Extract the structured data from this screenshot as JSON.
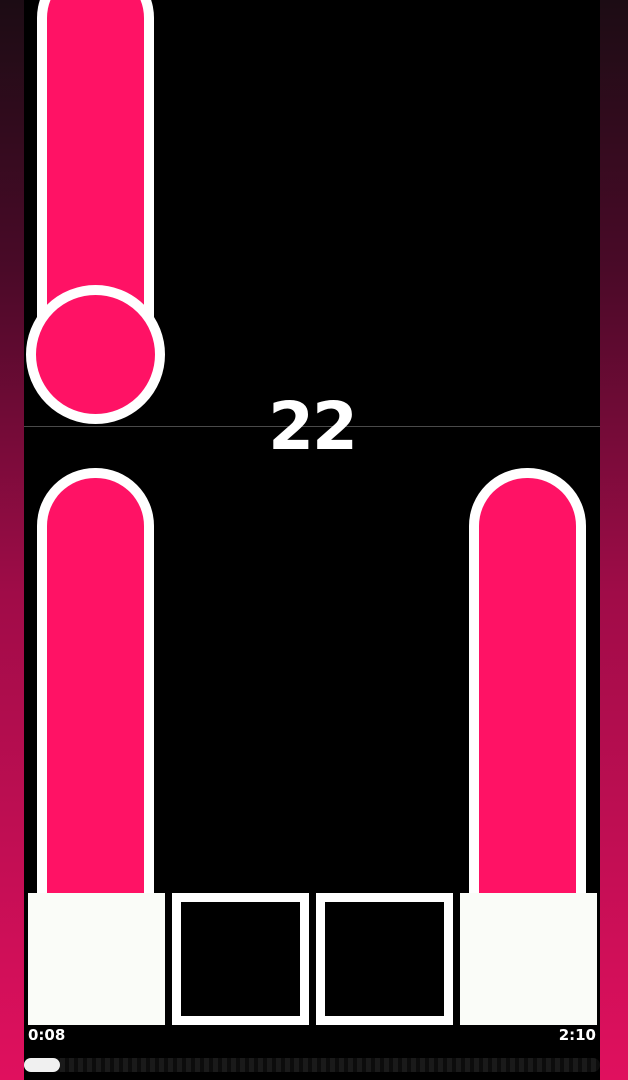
{
  "game": {
    "score": "22",
    "elapsed_time": "0:08",
    "total_time": "2:10",
    "progress": 0.062
  },
  "colors": {
    "note": "#ff1265",
    "outline": "#ffffff",
    "playfield": "#000000",
    "tile_active": "#fafcf8"
  },
  "tiles": [
    {
      "state": "pressed"
    },
    {
      "state": "empty"
    },
    {
      "state": "empty"
    },
    {
      "state": "pressed"
    }
  ]
}
